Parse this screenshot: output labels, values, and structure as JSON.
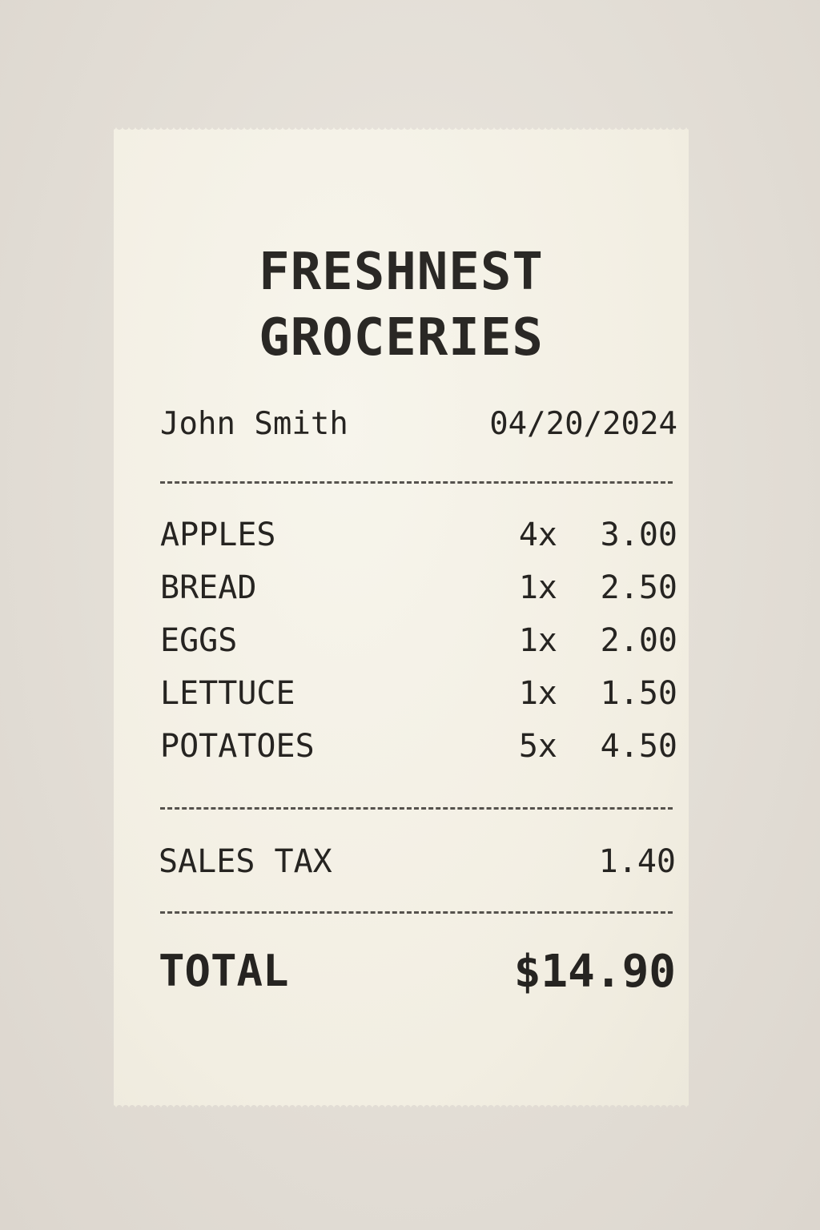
{
  "store": {
    "name_line1": "FRESHNEST",
    "name_line2": "GROCERIES"
  },
  "customer": "John Smith",
  "date": "04/20/2024",
  "divider": "------------------------------------",
  "items": [
    {
      "name": "APPLES",
      "qty": "4x",
      "price": "3.00"
    },
    {
      "name": "BREAD",
      "qty": "1x",
      "price": "2.50"
    },
    {
      "name": "EGGS",
      "qty": "1x",
      "price": "2.00"
    },
    {
      "name": "LETTUCE",
      "qty": "1x",
      "price": "1.50"
    },
    {
      "name": "POTATOES",
      "qty": "5x",
      "price": "4.50"
    }
  ],
  "tax": {
    "label": "SALES TAX",
    "value": "1.40"
  },
  "total": {
    "label": "TOTAL",
    "value": "$14.90"
  },
  "colors": {
    "background": "#e4dfd8",
    "paper": "#f4f1e6",
    "ink": "#262421"
  }
}
